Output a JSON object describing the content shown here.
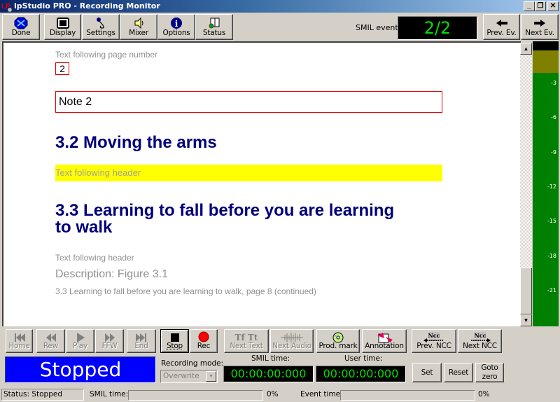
{
  "window": {
    "title": "lpStudio PRO - Recording Monitor",
    "app_icon": "lp-logo-icon",
    "controls": {
      "minimize": "_",
      "restore": "❐",
      "close": "✕"
    }
  },
  "toolbar": {
    "buttons": [
      {
        "label": "Done",
        "icon": "done-icon"
      },
      {
        "label": "Display",
        "icon": "display-icon"
      },
      {
        "label": "Settings",
        "icon": "microphone-icon"
      },
      {
        "label": "Mixer",
        "icon": "speaker-icon"
      },
      {
        "label": "Options",
        "icon": "info-icon"
      },
      {
        "label": "Status",
        "icon": "book-icon"
      }
    ],
    "smil_event_label": "SMIL event:",
    "smil_event_value": "2/2",
    "prev_event_label": "Prev. Ev.",
    "next_event_label": "Next Ev."
  },
  "document": {
    "text_after_page": "Text following page number",
    "page_number": "2",
    "note": "Note 2",
    "heading_1": "3.2 Moving the arms",
    "highlighted_text": "Text following header",
    "heading_2_line1": "3.3 Learning to fall before you are learning",
    "heading_2_line2": "to walk",
    "text_after_header": "Text following header",
    "description": "Description: Figure 3.1",
    "continued": "3.3 Learning to fall before you are learning to walk, page 8 (continued)",
    "highlight_color": "#ffff00",
    "heading_color": "#00007a"
  },
  "vu_meter": {
    "ticks": [
      "-3",
      "-6",
      "-9",
      "-12",
      "-15",
      "-18",
      "-21"
    ]
  },
  "transport": {
    "buttons": [
      {
        "label": "Home",
        "enabled": false
      },
      {
        "label": "Rew",
        "enabled": false
      },
      {
        "label": "Play",
        "enabled": false
      },
      {
        "label": "FFW",
        "enabled": false
      },
      {
        "label": "End",
        "enabled": false
      },
      {
        "label": "Stop",
        "enabled": true
      },
      {
        "label": "Rec",
        "enabled": true
      },
      {
        "label": "Next Text",
        "enabled": false
      },
      {
        "label": "Next Audio",
        "enabled": false
      },
      {
        "label": "Prod. mark",
        "enabled": true
      },
      {
        "label": "Annotation",
        "enabled": true
      },
      {
        "label": "Prev. NCC",
        "enabled": true
      },
      {
        "label": "Next NCC",
        "enabled": true
      }
    ],
    "ncc_icon_text": "Ncc",
    "tt_icon_text": "Tf Tt"
  },
  "status_panel": {
    "state": "Stopped",
    "recording_mode_label": "Recording mode:",
    "recording_mode_value": "Overwrite",
    "smil_time_label": "SMIL time:",
    "smil_time_value": "00:00:00:000",
    "user_time_label": "User time:",
    "user_time_value": "00:00:00:000",
    "set_label": "Set",
    "reset_label": "Reset",
    "goto_zero_line1": "Goto",
    "goto_zero_line2": "zero"
  },
  "statusbar": {
    "status": "Status: Stopped",
    "smil_time_label": "SMIL time:",
    "smil_time_percent": "0%",
    "smil_progress": 0,
    "event_time_label": "Event time:",
    "event_time_percent": "0%",
    "event_progress": 0
  }
}
